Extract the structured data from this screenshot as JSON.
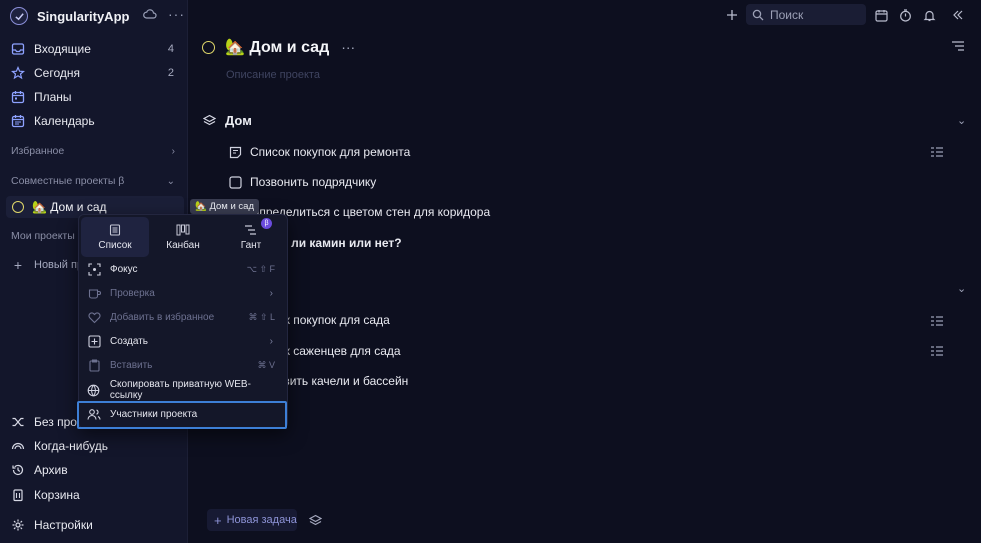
{
  "app": {
    "name": "SingularityApp"
  },
  "sidebar": {
    "items": [
      {
        "label": "Входящие",
        "count": "4",
        "icon": "inbox-icon"
      },
      {
        "label": "Сегодня",
        "count": "2",
        "icon": "star-icon"
      },
      {
        "label": "Планы",
        "count": "",
        "icon": "plans-calendar-icon"
      },
      {
        "label": "Календарь",
        "count": "",
        "icon": "calendar-icon"
      }
    ],
    "favorites_label": "Избранное",
    "shared_label": "Совместные проекты β",
    "shared_project": "🏡 Дом и сад",
    "my_projects_label": "Мои проекты",
    "new_project_label": "Новый прое",
    "bottom": [
      {
        "label": "Без проекта",
        "icon": "shuffle-icon"
      },
      {
        "label": "Когда-нибудь",
        "icon": "rainbow-icon"
      },
      {
        "label": "Архив",
        "icon": "history-icon"
      },
      {
        "label": "Корзина",
        "icon": "trash-icon"
      },
      {
        "label": "Настройки",
        "icon": "gear-icon"
      }
    ]
  },
  "topbar": {
    "search_placeholder": "Поиск"
  },
  "project": {
    "title": "🏡 Дом и сад",
    "description_placeholder": "Описание проекта",
    "group1": "Дом",
    "tasks1": [
      "Список покупок для ремонта",
      "Позвонить подрядчику",
      "Определиться с цветом стен для коридора",
      "Нужен ли камин или нет?"
    ],
    "tasks2": [
      "Список покупок для сада",
      "Список саженцев для сада",
      "Поставить качели и бассейн"
    ],
    "new_task_label": "Новая задача"
  },
  "tooltip": "🏡 Дом и сад",
  "context_menu": {
    "views": [
      {
        "label": "Список"
      },
      {
        "label": "Канбан"
      },
      {
        "label": "Гант",
        "badge": "β"
      }
    ],
    "items": [
      {
        "label": "Фокус",
        "shortcut": "⌥ ⇧ F"
      },
      {
        "label": "Проверка",
        "arrow": "›"
      },
      {
        "label": "Добавить в избранное",
        "shortcut": "⌘ ⇧ L"
      },
      {
        "label": "Создать",
        "arrow": "›"
      },
      {
        "label": "Вставить",
        "shortcut": "⌘ V"
      },
      {
        "label": "Скопировать приватную WEB-ссылку"
      },
      {
        "label": "Участники проекта"
      }
    ]
  },
  "colors": {
    "accent": "#3d7fd6",
    "project_ring": "#e0d86a",
    "beta": "#6a4bdc"
  }
}
